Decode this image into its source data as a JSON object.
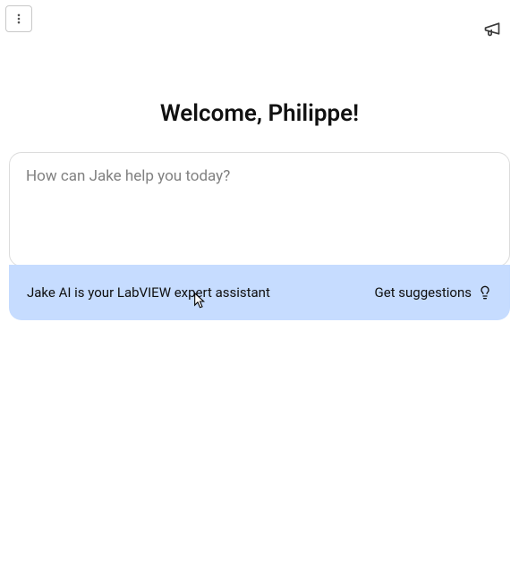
{
  "header": {
    "welcome_text": "Welcome, Philippe!"
  },
  "input": {
    "placeholder": "How can Jake help you today?",
    "value": ""
  },
  "banner": {
    "info_text": "Jake AI is your LabVIEW expert assistant",
    "suggestions_label": "Get suggestions"
  },
  "icons": {
    "menu": "more-vertical-icon",
    "announce": "megaphone-icon",
    "suggestion": "lightbulb-icon"
  }
}
